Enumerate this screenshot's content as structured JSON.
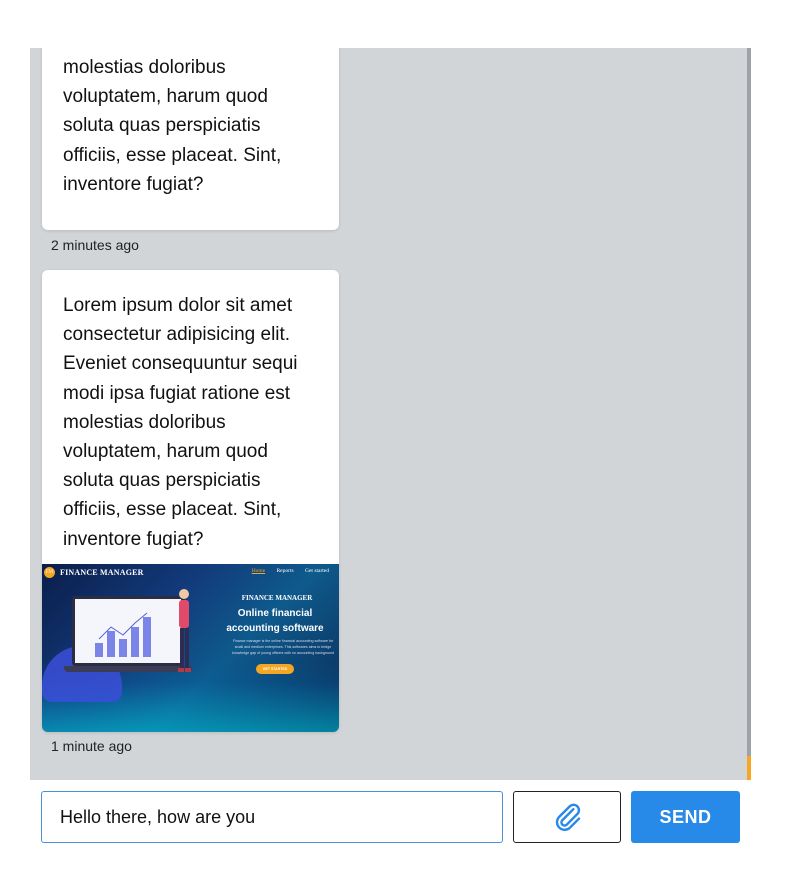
{
  "messages": [
    {
      "text": "molestias doloribus voluptatem, harum quod soluta quas perspiciatis officiis, esse placeat. Sint, inventore fugiat?",
      "time": "2 minutes ago"
    },
    {
      "text": "Lorem ipsum dolor sit amet consectetur adipisicing elit. Eveniet consequuntur sequi modi ipsa fugiat ratione est molestias doloribus voluptatem, harum quod soluta quas perspiciatis officiis, esse placeat. Sint, inventore fugiat?",
      "time": "1 minute ago",
      "attachment": {
        "logo_text": "FM",
        "brand": "FINANCE MANAGER",
        "nav": [
          "Home",
          "Reports",
          "Get started"
        ],
        "hero_title": "FINANCE MANAGER",
        "hero_heading": "Online financial accounting software",
        "hero_desc": "Finance manager is the online financial accounting software for small and medium enterprises. This softwares aims to bridge knowledge gap of young officers with no accounting background",
        "cta": "GET STARTED"
      }
    }
  ],
  "composer": {
    "input_value": "Hello there, how are you",
    "send_label": "SEND",
    "attach_icon": "paperclip-icon"
  },
  "colors": {
    "chat_bg": "#d2d5d8",
    "send_bg": "#2789e8",
    "input_border": "#4a90d9",
    "scroll_accent": "#f5a623"
  }
}
